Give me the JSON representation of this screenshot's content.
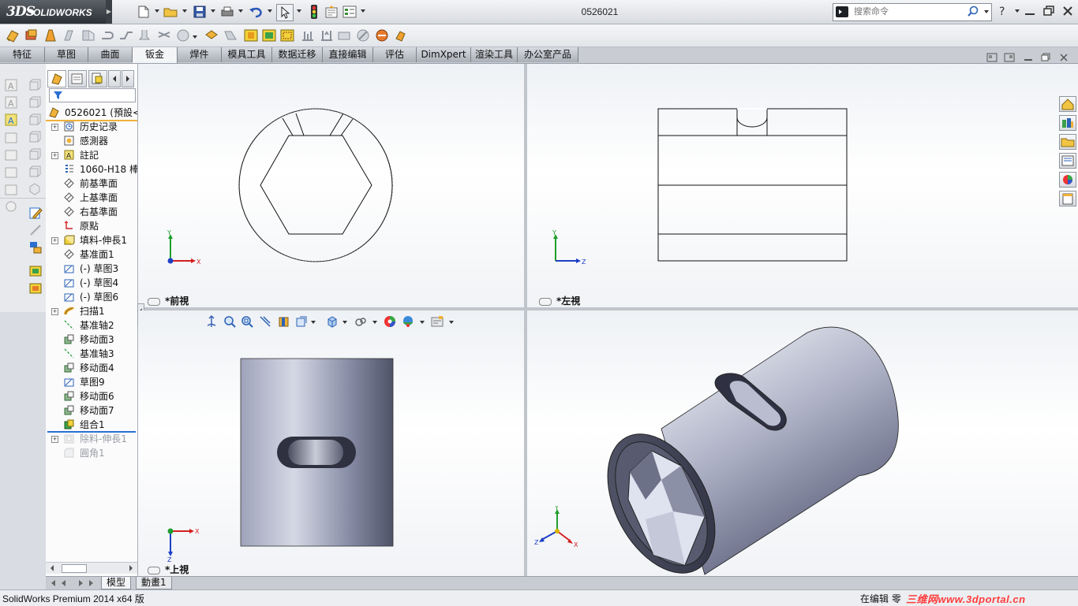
{
  "app": {
    "brand_prefix": "3DS",
    "brand_name": "SOLIDWORKS",
    "document_title": "0526021"
  },
  "search": {
    "placeholder": "搜索命令"
  },
  "tabs": [
    {
      "label": "特征"
    },
    {
      "label": "草图"
    },
    {
      "label": "曲面"
    },
    {
      "label": "钣金",
      "active": true
    },
    {
      "label": "焊件"
    },
    {
      "label": "模具工具"
    },
    {
      "label": "数据迁移"
    },
    {
      "label": "直接编辑"
    },
    {
      "label": "评估"
    },
    {
      "label": "DimXpert"
    },
    {
      "label": "渲染工具"
    },
    {
      "label": "办公室产品"
    }
  ],
  "tree": {
    "root": "0526021  (預設<",
    "items": [
      {
        "label": "历史记录",
        "icon": "history-icon",
        "expandable": true
      },
      {
        "label": "感測器",
        "icon": "sensor-icon"
      },
      {
        "label": "註記",
        "icon": "annotation-icon",
        "expandable": true
      },
      {
        "label": "1060-H18 棒",
        "icon": "material-icon"
      },
      {
        "label": "前基準面",
        "icon": "plane-icon"
      },
      {
        "label": "上基準面",
        "icon": "plane-icon"
      },
      {
        "label": "右基準面",
        "icon": "plane-icon"
      },
      {
        "label": "原點",
        "icon": "origin-icon"
      },
      {
        "label": "填料-伸長1",
        "icon": "extrude-icon",
        "expandable": true
      },
      {
        "label": "基准面1",
        "icon": "plane-icon"
      },
      {
        "label": "(-) 草图3",
        "icon": "sketch-icon"
      },
      {
        "label": "(-) 草图4",
        "icon": "sketch-icon"
      },
      {
        "label": "(-) 草图6",
        "icon": "sketch-icon"
      },
      {
        "label": "扫描1",
        "icon": "sweep-icon",
        "expandable": true
      },
      {
        "label": "基准轴2",
        "icon": "axis-icon"
      },
      {
        "label": "移动面3",
        "icon": "move-face-icon"
      },
      {
        "label": "基准轴3",
        "icon": "axis-icon"
      },
      {
        "label": "移动面4",
        "icon": "move-face-icon"
      },
      {
        "label": "草图9",
        "icon": "sketch-icon"
      },
      {
        "label": "移动面6",
        "icon": "move-face-icon"
      },
      {
        "label": "移动面7",
        "icon": "move-face-icon"
      },
      {
        "label": "组合1",
        "icon": "combine-icon"
      },
      {
        "label": "除料-伸長1",
        "icon": "cut-extrude-icon",
        "expandable": true,
        "suppressed": true
      },
      {
        "label": "圓角1",
        "icon": "fillet-icon",
        "suppressed": true
      }
    ]
  },
  "bottom_tabs": [
    {
      "label": "模型"
    },
    {
      "label": "動畫1"
    }
  ],
  "viewports": {
    "front": "*前視",
    "left": "*左視",
    "top": "*上視"
  },
  "axes": {
    "x": "X",
    "y": "Y",
    "z": "Z"
  },
  "status": {
    "left": "SolidWorks Premium 2014 x64 版",
    "right": "在编辑 零",
    "watermark": "三维网www.3dportal.cn"
  },
  "colors": {
    "accent": "#2a6fd1",
    "part": "#8a8fa8",
    "axis_x": "#d32020",
    "axis_y": "#1e9e2a",
    "axis_z": "#1c3fc4"
  }
}
